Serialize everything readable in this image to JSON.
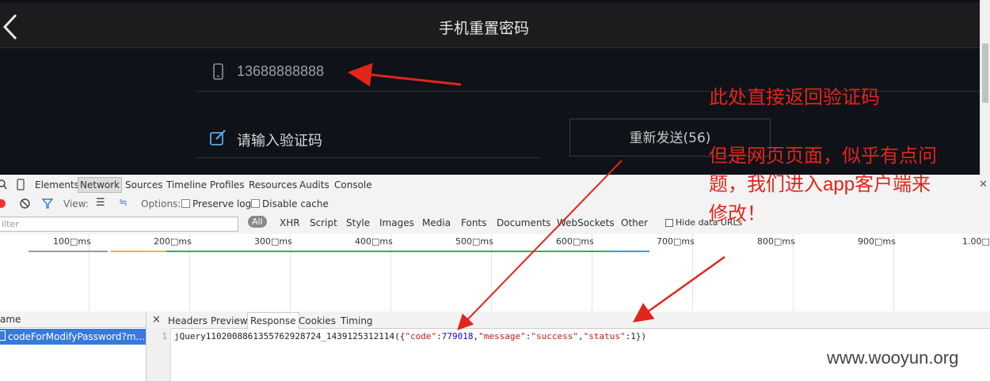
{
  "app": {
    "title": "手机重置密码",
    "phone_value": "13688888888",
    "code_placeholder": "请输入验证码",
    "resend_label": "重新发送(56)"
  },
  "devtools": {
    "tabs": [
      "Elements",
      "Network",
      "Sources",
      "Timeline",
      "Profiles",
      "Resources",
      "Audits",
      "Console"
    ],
    "toolbar": {
      "view_label": "View:",
      "options_label": "Options:",
      "preserve_log": "Preserve log",
      "disable_cache": "Disable cache"
    },
    "filter": {
      "placeholder": "ilter",
      "all": "All",
      "types": [
        "XHR",
        "Script",
        "Style",
        "Images",
        "Media",
        "Fonts",
        "Documents",
        "WebSockets",
        "Other"
      ],
      "hide_data_urls": "Hide data URLs"
    },
    "timeline_labels": [
      "100□ms",
      "200□ms",
      "300□ms",
      "400□ms",
      "500□ms",
      "600□ms",
      "700□ms",
      "800□ms",
      "900□ms",
      "1.00□"
    ],
    "name_header": "ame",
    "request_name": "codeForModifyPassword?m...",
    "response_tabs": [
      "Headers",
      "Preview",
      "Response",
      "Cookies",
      "Timing"
    ],
    "close_label": "×",
    "line_number": "1",
    "response": {
      "prefix": "jQuery110200886135576292872​4_1439125312114({",
      "k_code": "\"code\"",
      "v_code": "779018",
      "k_message": "\"message\"",
      "v_message": "\"success\"",
      "k_status": "\"status\"",
      "v_status": "1",
      "suffix": "})"
    }
  },
  "annotations": {
    "a1": "此处直接返回验证码",
    "a2_l1": "但是网页页面，似乎有点问",
    "a2_l2a": "题，我们进入",
    "a2_l2b": "app",
    "a2_l2c": "客户端来",
    "a2_l3": "修改！"
  },
  "watermark": "www.wooyun.org",
  "colors": {
    "annotation": "#e3241b",
    "app_bg": "#0f1218",
    "selected_row": "#3879d9"
  }
}
